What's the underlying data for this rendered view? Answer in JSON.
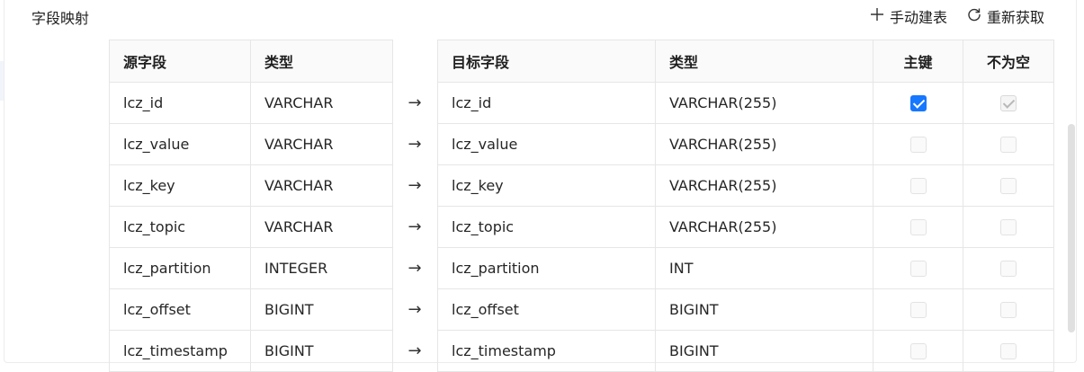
{
  "section_title": "字段映射",
  "toolbar": {
    "manual_create_label": "手动建表",
    "refresh_label": "重新获取"
  },
  "source_table": {
    "headers": [
      "源字段",
      "类型"
    ],
    "rows": [
      {
        "field": "lcz_id",
        "type": "VARCHAR"
      },
      {
        "field": "lcz_value",
        "type": "VARCHAR"
      },
      {
        "field": "lcz_key",
        "type": "VARCHAR"
      },
      {
        "field": "lcz_topic",
        "type": "VARCHAR"
      },
      {
        "field": "lcz_partition",
        "type": "INTEGER"
      },
      {
        "field": "lcz_offset",
        "type": "BIGINT"
      },
      {
        "field": "lcz_timestamp",
        "type": "BIGINT"
      }
    ]
  },
  "arrow_glyph": "→",
  "target_table": {
    "headers": [
      "目标字段",
      "类型",
      "主键",
      "不为空"
    ],
    "rows": [
      {
        "field": "lcz_id",
        "type": "VARCHAR(255)",
        "primary_key": true,
        "not_null": true,
        "not_null_disabled": true
      },
      {
        "field": "lcz_value",
        "type": "VARCHAR(255)",
        "primary_key": false,
        "not_null": false
      },
      {
        "field": "lcz_key",
        "type": "VARCHAR(255)",
        "primary_key": false,
        "not_null": false
      },
      {
        "field": "lcz_topic",
        "type": "VARCHAR(255)",
        "primary_key": false,
        "not_null": false
      },
      {
        "field": "lcz_partition",
        "type": "INT",
        "primary_key": false,
        "not_null": false
      },
      {
        "field": "lcz_offset",
        "type": "BIGINT",
        "primary_key": false,
        "not_null": false
      },
      {
        "field": "lcz_timestamp",
        "type": "BIGINT",
        "primary_key": false,
        "not_null": false
      }
    ]
  },
  "colors": {
    "accent": "#1677ff",
    "header_bg": "#fafafa",
    "border": "#e6e6e6"
  }
}
